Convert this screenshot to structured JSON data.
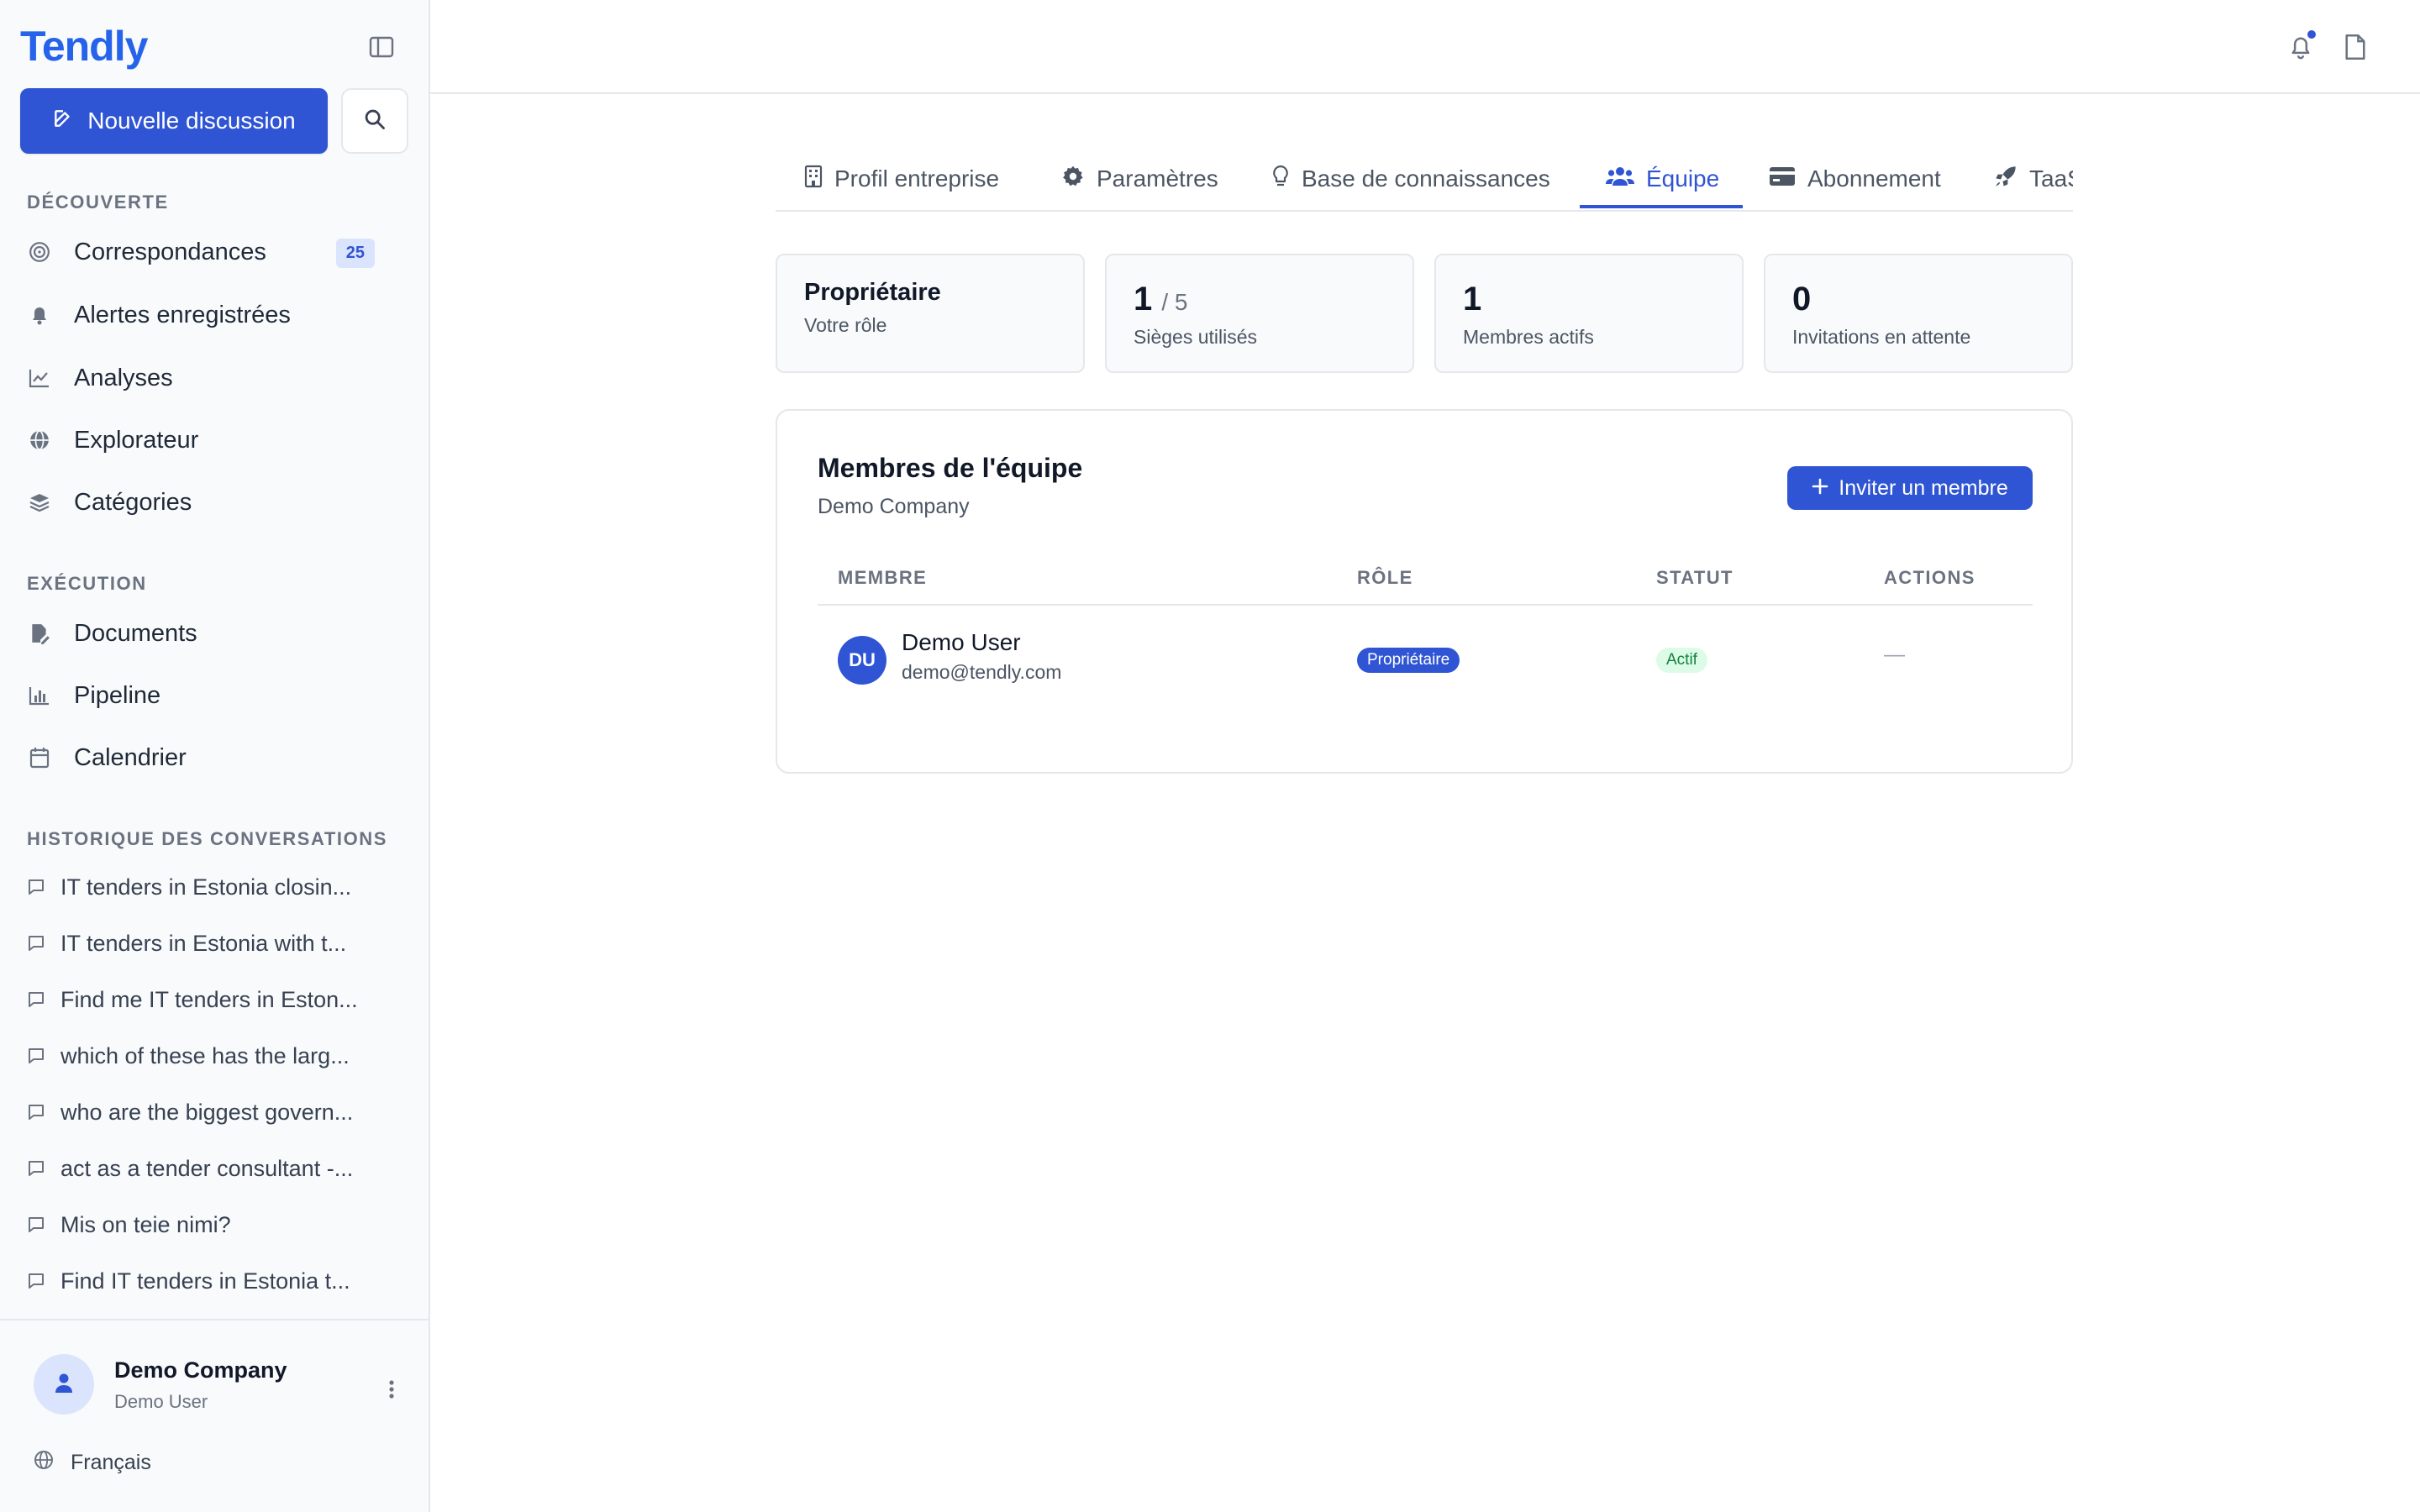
{
  "app": {
    "logo": "Tendly"
  },
  "sidebar": {
    "new_chat_label": "Nouvelle discussion",
    "sections": {
      "discover": "DÉCOUVERTE",
      "execution": "EXÉCUTION",
      "history": "HISTORIQUE DES CONVERSATIONS"
    },
    "discover_items": [
      {
        "label": "Correspondances",
        "icon": "target-icon",
        "badge": "25"
      },
      {
        "label": "Alertes enregistrées",
        "icon": "bell-icon"
      },
      {
        "label": "Analyses",
        "icon": "line-chart-icon"
      },
      {
        "label": "Explorateur",
        "icon": "globe-icon"
      },
      {
        "label": "Catégories",
        "icon": "layers-icon"
      }
    ],
    "execution_items": [
      {
        "label": "Documents",
        "icon": "file-edit-icon"
      },
      {
        "label": "Pipeline",
        "icon": "bar-chart-icon"
      },
      {
        "label": "Calendrier",
        "icon": "calendar-icon"
      }
    ],
    "history": [
      "IT tenders in Estonia closin...",
      "IT tenders in Estonia with t...",
      "Find me IT tenders in Eston...",
      "which of these has the larg...",
      "who are the biggest govern...",
      "act as a tender consultant -...",
      "Mis on teie nimi?",
      "Find IT tenders in Estonia t..."
    ],
    "profile": {
      "company": "Demo Company",
      "user": "Demo User"
    },
    "language": "Français"
  },
  "tabs": [
    {
      "label": "Profil entreprise",
      "icon": "building-icon"
    },
    {
      "label": "Paramètres",
      "icon": "gear-icon"
    },
    {
      "label": "Base de connaissances",
      "icon": "lightbulb-icon"
    },
    {
      "label": "Équipe",
      "icon": "users-icon",
      "active": true
    },
    {
      "label": "Abonnement",
      "icon": "credit-card-icon"
    },
    {
      "label": "TaaS",
      "icon": "rocket-icon"
    }
  ],
  "stats": {
    "role": {
      "title": "Propriétaire",
      "label": "Votre rôle"
    },
    "seats": {
      "used": "1",
      "total": "/ 5",
      "label": "Sièges utilisés"
    },
    "active": {
      "value": "1",
      "label": "Membres actifs"
    },
    "pending": {
      "value": "0",
      "label": "Invitations en attente"
    }
  },
  "members_card": {
    "title": "Membres de l'équipe",
    "subtitle": "Demo Company",
    "invite_label": "Inviter un membre",
    "columns": [
      "MEMBRE",
      "RÔLE",
      "STATUT",
      "ACTIONS"
    ],
    "rows": [
      {
        "initials": "DU",
        "name": "Demo User",
        "email": "demo@tendly.com",
        "role": "Propriétaire",
        "status": "Actif",
        "actions": "—"
      }
    ]
  },
  "colors": {
    "accent": "#2f55d4",
    "success_bg": "#dcfce7",
    "success_text": "#15803d"
  }
}
